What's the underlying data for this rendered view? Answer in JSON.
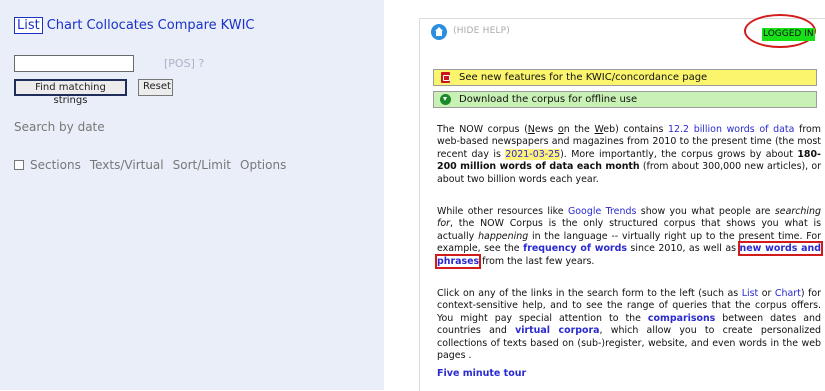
{
  "tabs": [
    "List",
    "Chart",
    "Collocates",
    "Compare",
    "KWIC"
  ],
  "search": {
    "input_value": "",
    "pos_label": "[POS]",
    "pos_help": "?",
    "find_label": "Find matching strings",
    "reset_label": "Reset",
    "search_by_date": "Search by date"
  },
  "options_row": {
    "sections": "Sections",
    "texts_virtual": "Texts/Virtual",
    "sort_limit": "Sort/Limit",
    "options": "Options"
  },
  "help_header": {
    "hide_help": "(HIDE HELP)",
    "logged_in": "LOGGED IN"
  },
  "notices": {
    "kwic": "See new features for the KWIC/concordance page",
    "download": "Download the corpus for offline use"
  },
  "p1": {
    "a": "The NOW corpus (",
    "b": "N",
    "c": "ews ",
    "d": "o",
    "e": "n the ",
    "f": "W",
    "g": "eb) contains ",
    "h": "12.2 billion words of data",
    "i": " from web-based newspapers and magazines from 2010 to the present time (the most recent day is ",
    "j": "2021-03-25",
    "k": "). More importantly, the corpus grows by about ",
    "l": "180-200 million words of data each month",
    "m": " (from about 300,000 new articles), or about two billion words each year."
  },
  "p2": {
    "a": "While other resources like ",
    "b": "Google Trends",
    "c": " show you what people are ",
    "d": "searching for",
    "e": ", the NOW Corpus is the only structured corpus that shows you what is actually ",
    "f": "happening",
    "g": " in the language -- virtually right up to the present time. For example, see the ",
    "h": "frequency of words",
    "i": " since 2010, as well as ",
    "j": "new words and",
    "k": " ",
    "l": "phrases",
    "m": " from the last few years."
  },
  "p3": {
    "a": "Click on any of the links in the search form to the left (such as ",
    "b": "List",
    "c": " or ",
    "d": "Chart",
    "e": ") for context-sensitive help, and to see the range of queries that the corpus offers. You might pay special attention to the ",
    "f": "comparisons",
    "g": " between dates and countries and ",
    "h": "virtual corpora",
    "i": ", which allow you to create personalized collections of texts based on (sub-)register, website, and even words in the web pages ."
  },
  "tour": "Five minute tour",
  "colors": {
    "link_blue": "#1a32c8",
    "logged_in_green": "#17e017",
    "annotation_red": "#d21b1b",
    "notice_yellow": "#fbf56e",
    "notice_green": "#c9f1b5",
    "left_bg": "#e9eef8"
  },
  "icons": {
    "home": "home-icon",
    "pdf": "pdf-icon",
    "download": "download-icon",
    "checkbox": "checkbox-icon"
  }
}
